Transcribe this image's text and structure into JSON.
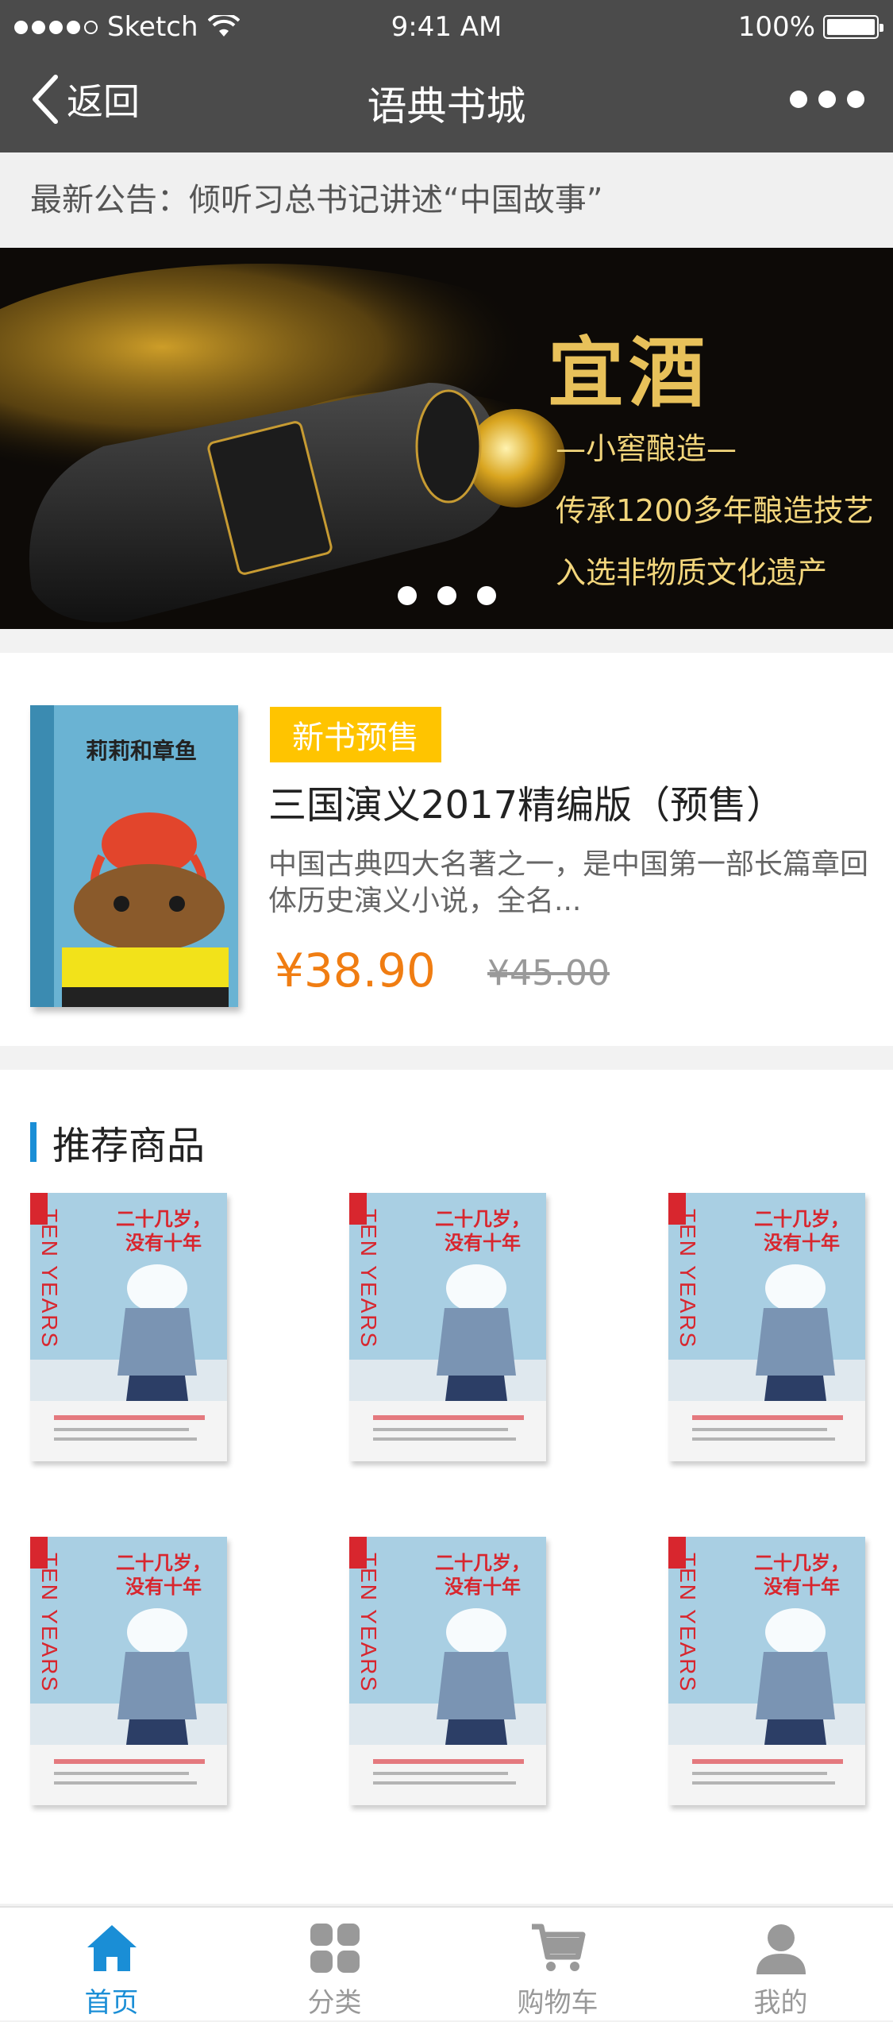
{
  "status_bar": {
    "carrier": "Sketch",
    "time": "9:41 AM",
    "battery": "100%"
  },
  "nav": {
    "back_label": "返回",
    "title": "语典书城"
  },
  "notice": {
    "text": "最新公告：倾听习总书记讲述“中国故事”"
  },
  "banner": {
    "title": "宜酒",
    "line1": "—小窖酿造—",
    "line2": "传承1200多年酿造技艺",
    "line3": "入选非物质文化遗产",
    "pages": 3,
    "active_page": 1
  },
  "featured": {
    "cover_title": "莉莉和章鱼",
    "tag": "新书预售",
    "name": "三国演义2017精编版（预售）",
    "description": "中国古典四大名著之一，是中国第一部长篇章回体历史演义小说，全名...",
    "price": "¥38.90",
    "original_price": "¥45.00"
  },
  "recommend": {
    "heading": "推荐商品",
    "books": [
      {
        "cn_title": "二十几岁，没有十年",
        "en_title": "TEN YEARS"
      },
      {
        "cn_title": "二十几岁，没有十年",
        "en_title": "TEN YEARS"
      },
      {
        "cn_title": "二十几岁，没有十年",
        "en_title": "TEN YEARS"
      },
      {
        "cn_title": "二十几岁，没有十年",
        "en_title": "TEN YEARS"
      },
      {
        "cn_title": "二十几岁，没有十年",
        "en_title": "TEN YEARS"
      },
      {
        "cn_title": "二十几岁，没有十年",
        "en_title": "TEN YEARS"
      }
    ]
  },
  "tabbar": {
    "items": [
      {
        "label": "首页",
        "icon": "home-icon",
        "active": true
      },
      {
        "label": "分类",
        "icon": "category-icon",
        "active": false
      },
      {
        "label": "购物车",
        "icon": "cart-icon",
        "active": false
      },
      {
        "label": "我的",
        "icon": "user-icon",
        "active": false
      }
    ],
    "accent_color": "#1a8ed6",
    "inactive_color": "#999999"
  },
  "colors": {
    "header_bg": "#4b4b4b",
    "price": "#f07d12",
    "tag": "#ffc400",
    "section_bar": "#1a8ed6"
  }
}
